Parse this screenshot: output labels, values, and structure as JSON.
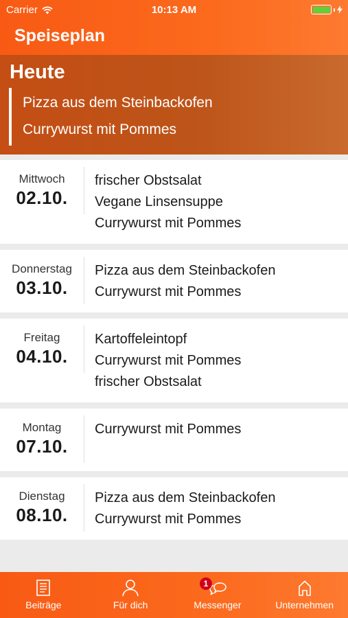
{
  "status_bar": {
    "carrier": "Carrier",
    "time": "10:13 AM",
    "battery_color": "#5cd33c"
  },
  "header": {
    "title": "Speiseplan",
    "accent": "#f85a14"
  },
  "today": {
    "title": "Heute",
    "meals": [
      "Pizza aus dem Steinbackofen",
      "Currywurst mit Pommes"
    ]
  },
  "days": [
    {
      "weekday": "Mittwoch",
      "date": "02.10.",
      "meals": [
        "frischer Obstsalat",
        "Vegane Linsensuppe",
        "Currywurst mit Pommes"
      ]
    },
    {
      "weekday": "Donnerstag",
      "date": "03.10.",
      "meals": [
        "Pizza aus dem Steinbackofen",
        "Currywurst mit Pommes"
      ]
    },
    {
      "weekday": "Freitag",
      "date": "04.10.",
      "meals": [
        "Kartoffeleintopf",
        "Currywurst mit Pommes",
        "frischer Obstsalat"
      ]
    },
    {
      "weekday": "Montag",
      "date": "07.10.",
      "meals": [
        "Currywurst mit Pommes"
      ]
    },
    {
      "weekday": "Dienstag",
      "date": "08.10.",
      "meals": [
        "Pizza aus dem Steinbackofen",
        "Currywurst mit Pommes"
      ]
    }
  ],
  "tabs": [
    {
      "label": "Beiträge",
      "icon": "newspaper-icon"
    },
    {
      "label": "Für dich",
      "icon": "person-icon"
    },
    {
      "label": "Messenger",
      "icon": "chat-bubbles-icon",
      "badge": "1"
    },
    {
      "label": "Unternehmen",
      "icon": "home-icon"
    }
  ]
}
